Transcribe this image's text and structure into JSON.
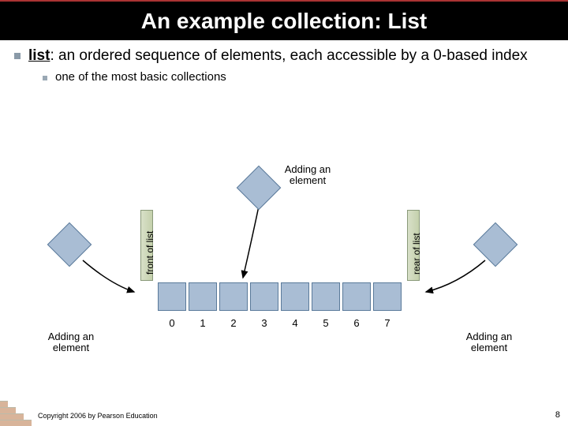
{
  "title": "An example collection: List",
  "bullet": {
    "term": "list",
    "definition": ": an ordered sequence of elements, each accessible by a 0-based index",
    "sub": "one of the most basic collections"
  },
  "diagram": {
    "front_label": "front of list",
    "rear_label": "rear of list",
    "add_top": "Adding an\nelement",
    "add_left": "Adding an\nelement",
    "add_right": "Adding an\nelement",
    "indices": [
      "0",
      "1",
      "2",
      "3",
      "4",
      "5",
      "6",
      "7"
    ]
  },
  "footer": "Copyright 2006 by Pearson Education",
  "page": "8"
}
